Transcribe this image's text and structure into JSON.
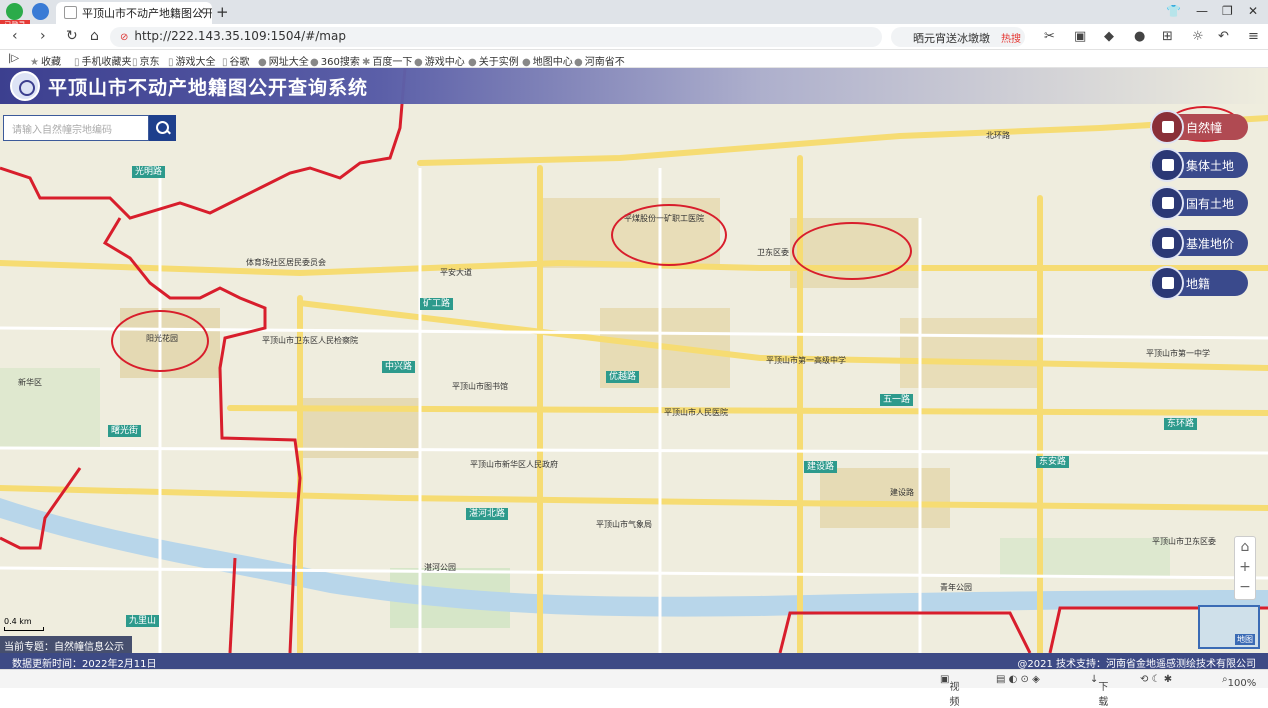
{
  "browser": {
    "badge": "已登录",
    "tab_title": "平顶山市不动产地籍图公开查询系",
    "url": "http://222.143.35.109:1504/#/map",
    "search_text": "晒元宵送冰墩墩",
    "search_hot": "热搜",
    "bookmarks": [
      "收藏",
      "手机收藏夹",
      "京东",
      "游戏大全",
      "谷歌",
      "网址大全",
      "360搜索",
      "百度一下",
      "游戏中心",
      "关于实例",
      "地图中心",
      "河南省不"
    ]
  },
  "app": {
    "title": "平顶山市不动产地籍图公开查询系统",
    "search_placeholder": "请输入自然幢宗地编码",
    "layers": [
      {
        "label": "自然幢",
        "active": true
      },
      {
        "label": "集体土地",
        "active": false
      },
      {
        "label": "国有土地",
        "active": false
      },
      {
        "label": "基准地价",
        "active": false
      },
      {
        "label": "地籍",
        "active": false
      }
    ],
    "scale_label": "0.4 km",
    "current_topic": "当前专题：自然幢信息公示",
    "minimap_label": "地图"
  },
  "map_labels": {
    "roads": [
      "光明路",
      "矿工路",
      "中兴路",
      "优越路",
      "五一路",
      "建设路",
      "东环路",
      "东安路",
      "湛河北路",
      "九里山",
      "曙光街",
      "北环路",
      "平安大道",
      "青年公园"
    ],
    "places": [
      "卫东区委",
      "新华区",
      "平顶山市人民医院",
      "平顶山市第一高级中学",
      "湛河公园",
      "平顶山市第一中学",
      "体育场社区居民委员会",
      "平煤股份一矿职工医院",
      "阳光花园",
      "建设路",
      "平顶山市卫东区人民检察院",
      "平顶山市新华区人民政府",
      "平顶山市气象局",
      "平顶山市图书馆",
      "平顶山市卫东区委"
    ]
  },
  "footer": {
    "update": "数据更新时间：2022年2月11日",
    "support": "@2021 技术支持：河南省金地遥感测绘技术有限公司"
  },
  "statusbar": {
    "video": "视频",
    "zoom": "100%",
    "download": "下载"
  }
}
